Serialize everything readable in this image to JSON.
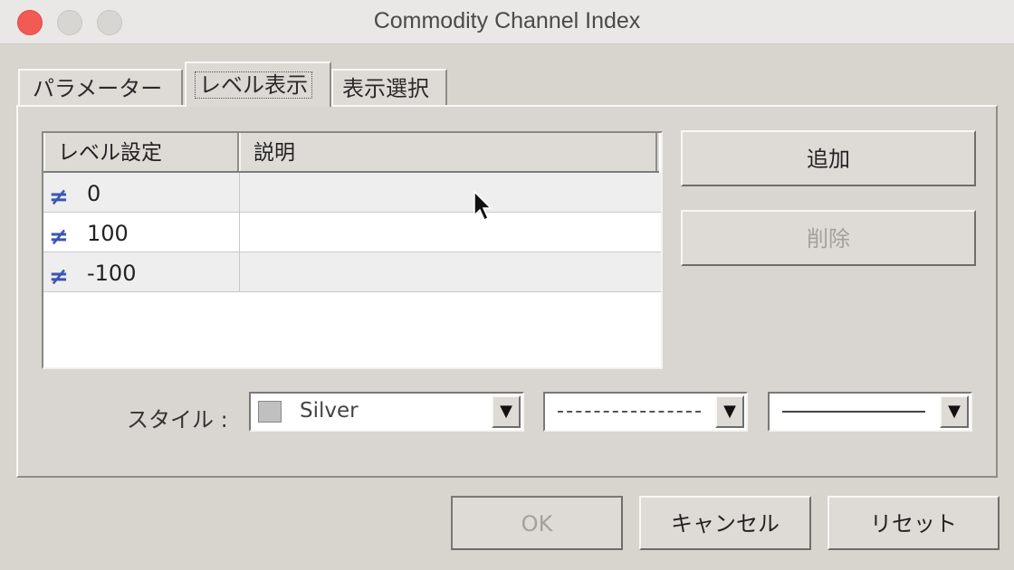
{
  "window": {
    "title": "Commodity Channel Index"
  },
  "tabs": [
    {
      "label": "パラメーター",
      "active": false
    },
    {
      "label": "レベル表示",
      "active": true
    },
    {
      "label": "表示選択",
      "active": false
    }
  ],
  "levels_table": {
    "headers": [
      "レベル設定",
      "説明"
    ],
    "rows": [
      {
        "icon": "not-equal-icon",
        "level": "0",
        "description": ""
      },
      {
        "icon": "not-equal-icon",
        "level": "100",
        "description": ""
      },
      {
        "icon": "not-equal-icon",
        "level": "-100",
        "description": ""
      }
    ]
  },
  "side_buttons": {
    "add_label": "追加",
    "delete_label": "削除"
  },
  "style": {
    "label": "スタイル :",
    "color_value": "Silver",
    "color_hex": "#c0c0c0"
  },
  "footer": {
    "ok_label": "OK",
    "cancel_label": "キャンセル",
    "reset_label": "リセット"
  },
  "colors": {
    "close": "#f25a54",
    "level_icon": "#3b55b5"
  }
}
